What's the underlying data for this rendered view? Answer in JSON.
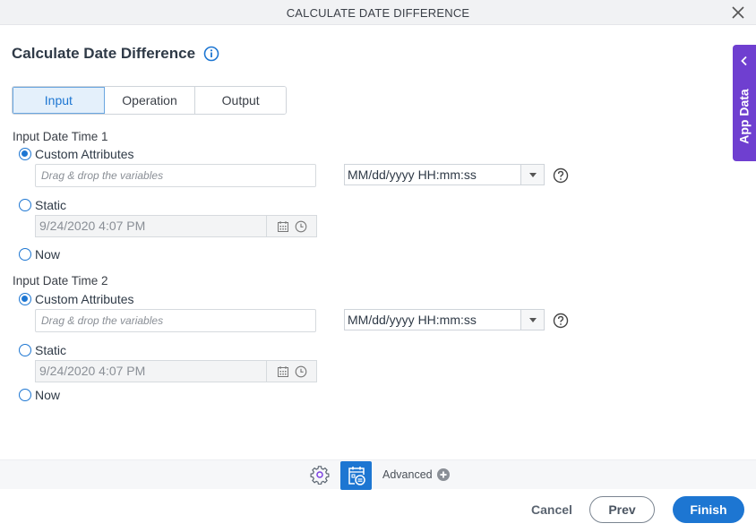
{
  "window": {
    "title": "CALCULATE DATE DIFFERENCE",
    "close_icon": "close-icon"
  },
  "page": {
    "heading": "Calculate Date Difference",
    "info_icon": "info-icon"
  },
  "tabs": [
    {
      "label": "Input",
      "active": true
    },
    {
      "label": "Operation",
      "active": false
    },
    {
      "label": "Output",
      "active": false
    }
  ],
  "input1": {
    "label": "Input Date Time 1",
    "options": {
      "custom": {
        "label": "Custom Attributes",
        "checked": true
      },
      "static": {
        "label": "Static",
        "checked": false
      },
      "now": {
        "label": "Now",
        "checked": false
      }
    },
    "drop_placeholder": "Drag & drop the variables",
    "static_value": "9/24/2020 4:07 PM",
    "format": "MM/dd/yyyy HH:mm:ss"
  },
  "input2": {
    "label": "Input Date Time 2",
    "options": {
      "custom": {
        "label": "Custom Attributes",
        "checked": true
      },
      "static": {
        "label": "Static",
        "checked": false
      },
      "now": {
        "label": "Now",
        "checked": false
      }
    },
    "drop_placeholder": "Drag & drop the variables",
    "static_value": "9/24/2020 4:07 PM",
    "format": "MM/dd/yyyy HH:mm:ss"
  },
  "side_panel": {
    "label": "App Data"
  },
  "toolbar": {
    "advanced_label": "Advanced"
  },
  "footer": {
    "cancel": "Cancel",
    "prev": "Prev",
    "finish": "Finish"
  },
  "colors": {
    "accent": "#1d76d2",
    "app_data": "#6f3fd0",
    "tab_active_bg": "#e4f0fb"
  }
}
